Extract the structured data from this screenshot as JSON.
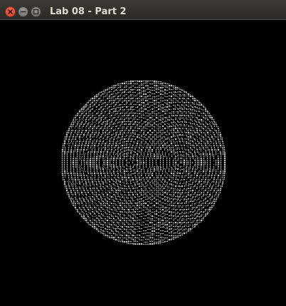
{
  "window": {
    "title": "Lab 08 - Part 2"
  },
  "controls": {
    "close_icon": "close-icon",
    "minimize_icon": "minimize-icon",
    "maximize_icon": "maximize-icon"
  },
  "colors": {
    "background": "#000000",
    "points": "#ffffff",
    "close": "#e0533d",
    "titlebar": "#3c3b37"
  }
}
